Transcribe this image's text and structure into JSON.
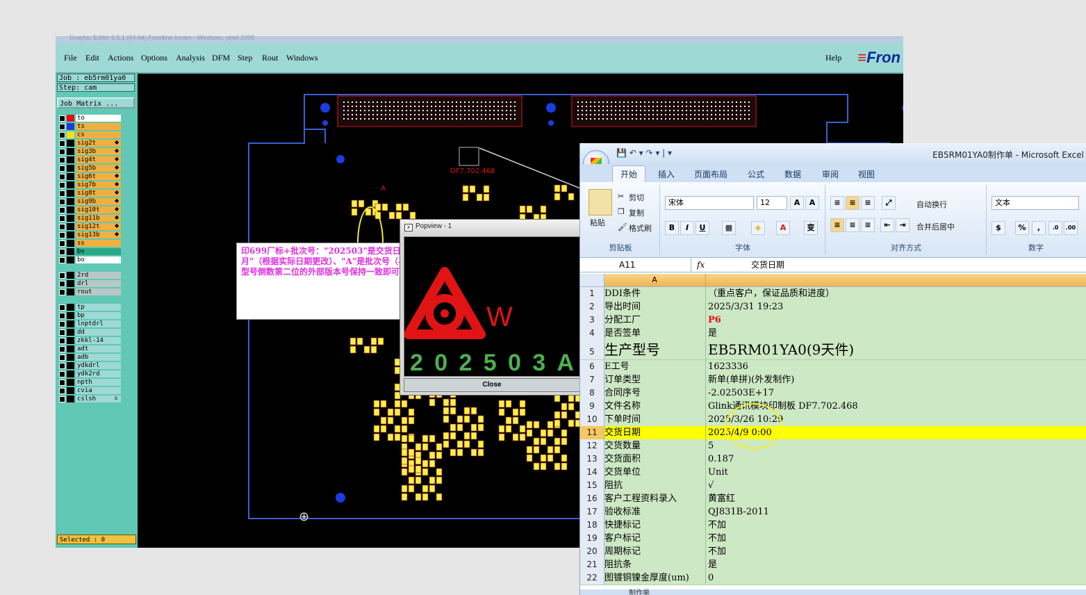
{
  "cam": {
    "title": "Graphic Editor 9.5.1 (64-bit) Frontline Incam - Windows, pixel 2009",
    "menu": [
      "File",
      "Edit",
      "Actions",
      "Options",
      "Analysis",
      "DFM",
      "Step",
      "Rout",
      "Windows"
    ],
    "help": "Help",
    "logo": "Fron",
    "job": "Job : eb5rm01ya0",
    "step": "Step: cam",
    "job_matrix": "Job Matrix ...",
    "selected": "Selected : 0",
    "layers": [
      {
        "name": "to",
        "color": "#ffffff",
        "swatch": "#e01414"
      },
      {
        "name": "ts",
        "color": "#f0b040",
        "swatch": "#1a3ce0"
      },
      {
        "name": "cs",
        "color": "#f0b040",
        "swatch": "#f0e020"
      },
      {
        "name": "sig2t",
        "color": "#f0b040",
        "swatch": "#000000",
        "arrow": "◆"
      },
      {
        "name": "sig3b",
        "color": "#f0b040",
        "swatch": "#000000",
        "arrow": "◆"
      },
      {
        "name": "sig4t",
        "color": "#f0b040",
        "swatch": "#000000",
        "arrow": "◆"
      },
      {
        "name": "sig5b",
        "color": "#f0b040",
        "swatch": "#000000",
        "arrow": "◆"
      },
      {
        "name": "sig6t",
        "color": "#f0b040",
        "swatch": "#000000",
        "arrow": "◆"
      },
      {
        "name": "sig7b",
        "color": "#f0b040",
        "swatch": "#000000",
        "arrow": "◆"
      },
      {
        "name": "sig8t",
        "color": "#f0b040",
        "swatch": "#000000",
        "arrow": "◆"
      },
      {
        "name": "sig9b",
        "color": "#f0b040",
        "swatch": "#000000",
        "arrow": "◆"
      },
      {
        "name": "sig10t",
        "color": "#f0b040",
        "swatch": "#000000",
        "arrow": "◆"
      },
      {
        "name": "sig11b",
        "color": "#f0b040",
        "swatch": "#000000",
        "arrow": "◆"
      },
      {
        "name": "sig12t",
        "color": "#f0b040",
        "swatch": "#000000",
        "arrow": "◆"
      },
      {
        "name": "sig13b",
        "color": "#f0b040",
        "swatch": "#000000",
        "arrow": "◆"
      },
      {
        "name": "ss",
        "color": "#f0b040",
        "swatch": "#000000"
      },
      {
        "name": "bs",
        "color": "#2aa888",
        "swatch": "#000000"
      },
      {
        "name": "bo",
        "color": "#ffffff",
        "swatch": "#000000"
      },
      {
        "name": "2rd",
        "color": "#b8c8c8",
        "swatch": "#000000"
      },
      {
        "name": "drl",
        "color": "#b8c8c8",
        "swatch": "#000000"
      },
      {
        "name": "rout",
        "color": "#b8c8c8",
        "swatch": "#000000"
      },
      {
        "name": "tp",
        "color": "#9ed9d5",
        "swatch": "#000000"
      },
      {
        "name": "bp",
        "color": "#9ed9d5",
        "swatch": "#000000"
      },
      {
        "name": "lnptdrl",
        "color": "#9ed9d5",
        "swatch": "#000000"
      },
      {
        "name": "dd",
        "color": "#9ed9d5",
        "swatch": "#000000"
      },
      {
        "name": "zkkl-14",
        "color": "#9ed9d5",
        "swatch": "#000000"
      },
      {
        "name": "adt",
        "color": "#9ed9d5",
        "swatch": "#000000"
      },
      {
        "name": "adb",
        "color": "#9ed9d5",
        "swatch": "#000000"
      },
      {
        "name": "ydkdrl",
        "color": "#9ed9d5",
        "swatch": "#000000"
      },
      {
        "name": "ydk2rd",
        "color": "#9ed9d5",
        "swatch": "#000000"
      },
      {
        "name": "npth",
        "color": "#9ed9d5",
        "swatch": "#000000"
      },
      {
        "name": "cvia",
        "color": "#9ed9d5",
        "swatch": "#000000"
      },
      {
        "name": "cslsh",
        "color": "#9ed9d5",
        "swatch": "#000000",
        "arrow": "s"
      }
    ],
    "board_text": "DF7.702.468",
    "board_marker": "A"
  },
  "callout": {
    "text": "印699厂标+批次号：\"202503\"是交货日期的\"年月\"（根据实际日期更改）、\"A\"是批次号（与我司生产型号倒数第二位的外部版本号保持一致即可）。"
  },
  "popview": {
    "title": "Popview - 1",
    "mark_letter": "W",
    "batch_code": "202503A",
    "close": "Close"
  },
  "excel": {
    "title": "EB5RM01YA0制作单 - Microsoft Excel",
    "tabs": [
      "开始",
      "插入",
      "页面布局",
      "公式",
      "数据",
      "审阅",
      "视图"
    ],
    "ribbon": {
      "paste": "粘贴",
      "cut": "剪切",
      "copy": "复制",
      "format_painter": "格式刷",
      "clipboard": "剪贴板",
      "font_name": "宋体",
      "font_size": "12",
      "font_group": "字体",
      "wrap": "自动换行",
      "merge": "合并后居中",
      "align_group": "对齐方式",
      "number_format": "文本",
      "number_group": "数字"
    },
    "name_box": "A11",
    "fx": "fx",
    "formula": "交货日期",
    "column_a": "A",
    "rows": [
      {
        "n": "1",
        "a": "DDI条件",
        "b": "（重点客户，保证品质和进度）"
      },
      {
        "n": "2",
        "a": "导出时间",
        "b": "2025/3/31 19:23"
      },
      {
        "n": "3",
        "a": "分配工厂",
        "b": "P6"
      },
      {
        "n": "4",
        "a": "是否签单",
        "b": "是"
      },
      {
        "n": "5",
        "a": "生产型号",
        "b": "EB5RM01YA0(9天件)"
      },
      {
        "n": "6",
        "a": "E工号",
        "b": "1623336"
      },
      {
        "n": "7",
        "a": "订单类型",
        "b": "新单(单拼)(外发制作)"
      },
      {
        "n": "8",
        "a": "合同序号",
        "b": "-2.02503E+17"
      },
      {
        "n": "9",
        "a": "文件名称",
        "b": "Glink通讯模块印制板 DF7.702.468"
      },
      {
        "n": "10",
        "a": "下单时间",
        "b": "2025/3/26 10:29"
      },
      {
        "n": "11",
        "a": "交货日期",
        "b": "2025/4/9 0:00"
      },
      {
        "n": "12",
        "a": "交货数量",
        "b": "5"
      },
      {
        "n": "13",
        "a": "交货面积",
        "b": "0.187"
      },
      {
        "n": "14",
        "a": "交货单位",
        "b": "Unit"
      },
      {
        "n": "15",
        "a": "阻抗",
        "b": "√"
      },
      {
        "n": "16",
        "a": "客户工程资料录入",
        "b": "黄富红"
      },
      {
        "n": "17",
        "a": "验收标准",
        "b": "QJ831B-2011"
      },
      {
        "n": "18",
        "a": "快捷标记",
        "b": "不加"
      },
      {
        "n": "19",
        "a": "客户标记",
        "b": "不加"
      },
      {
        "n": "20",
        "a": "周期标记",
        "b": "不加"
      },
      {
        "n": "21",
        "a": "阻抗条",
        "b": "是"
      },
      {
        "n": "22",
        "a": "图镀铜镍金厚度(um)",
        "b": "0"
      }
    ],
    "sheet_tab": "制作单"
  },
  "colors": {
    "accent": "#9ed9d5",
    "highlight": "#ffff00",
    "annotation": "#e030e0",
    "mark_red": "#e01414",
    "mark_green": "#4caf50"
  }
}
